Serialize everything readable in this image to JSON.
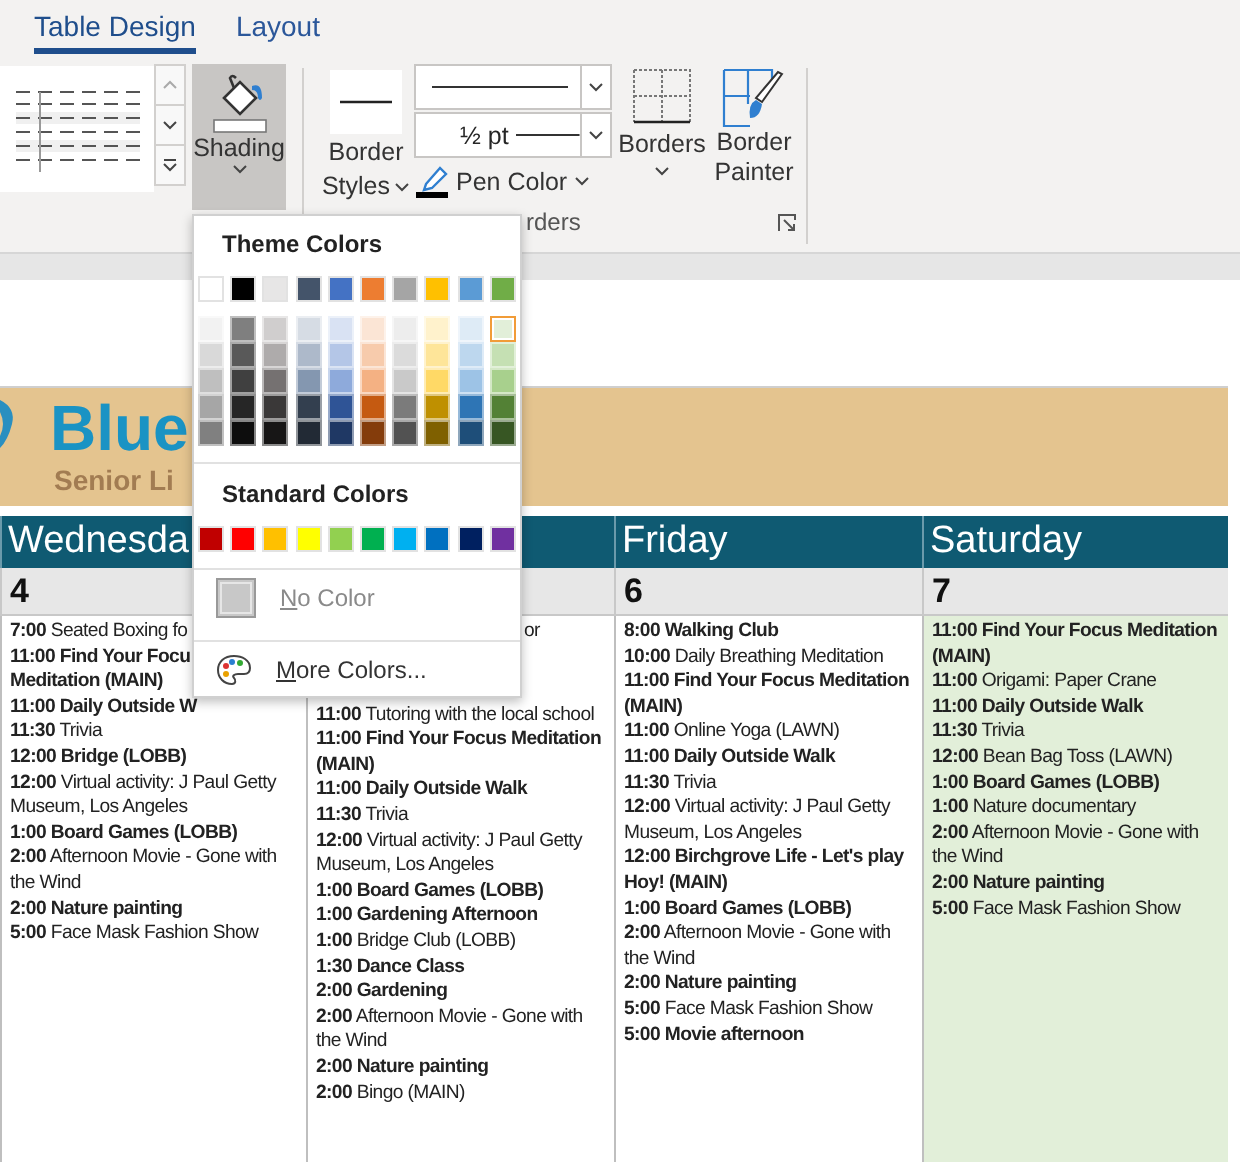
{
  "tabs": [
    {
      "label": "Table Design",
      "selected": true
    },
    {
      "label": "Layout",
      "selected": false
    }
  ],
  "ribbon": {
    "shading_button": {
      "label": "Shading",
      "pressed": true
    },
    "border_styles_button": {
      "label_lines": [
        "Border",
        "Styles"
      ]
    },
    "pen_weight": {
      "value": "½ pt"
    },
    "pen_color_button": {
      "label": "Pen Color"
    },
    "borders_button": {
      "label": "Borders"
    },
    "border_painter_button": {
      "label_lines": [
        "Border",
        "Painter"
      ]
    },
    "group_label": "rders"
  },
  "shading_menu": {
    "theme_title": "Theme Colors",
    "theme_colors": [
      {
        "color": "#ffffff",
        "selected": false,
        "shades": [
          {
            "color": "#f2f2f2",
            "selected": false
          },
          {
            "color": "#d9d9d9",
            "selected": false
          },
          {
            "color": "#bfbfbf",
            "selected": false
          },
          {
            "color": "#a6a6a6",
            "selected": false
          },
          {
            "color": "#808080",
            "selected": false
          }
        ]
      },
      {
        "color": "#000000",
        "selected": false,
        "shades": [
          {
            "color": "#7f7f7f",
            "selected": false
          },
          {
            "color": "#595959",
            "selected": false
          },
          {
            "color": "#404040",
            "selected": false
          },
          {
            "color": "#262626",
            "selected": false
          },
          {
            "color": "#0d0d0d",
            "selected": false
          }
        ]
      },
      {
        "color": "#e7e6e6",
        "selected": false,
        "shades": [
          {
            "color": "#d0cece",
            "selected": false
          },
          {
            "color": "#aeabab",
            "selected": false
          },
          {
            "color": "#757171",
            "selected": false
          },
          {
            "color": "#3a3838",
            "selected": false
          },
          {
            "color": "#171616",
            "selected": false
          }
        ]
      },
      {
        "color": "#44546a",
        "selected": false,
        "shades": [
          {
            "color": "#d6dce4",
            "selected": false
          },
          {
            "color": "#adb9ca",
            "selected": false
          },
          {
            "color": "#8497b0",
            "selected": false
          },
          {
            "color": "#333f4f",
            "selected": false
          },
          {
            "color": "#222a35",
            "selected": false
          }
        ]
      },
      {
        "color": "#4472c4",
        "selected": false,
        "shades": [
          {
            "color": "#d9e2f3",
            "selected": false
          },
          {
            "color": "#b4c6e7",
            "selected": false
          },
          {
            "color": "#8eaadb",
            "selected": false
          },
          {
            "color": "#2f5496",
            "selected": false
          },
          {
            "color": "#1f3864",
            "selected": false
          }
        ]
      },
      {
        "color": "#ed7d31",
        "selected": false,
        "shades": [
          {
            "color": "#fbe5d5",
            "selected": false
          },
          {
            "color": "#f7cbac",
            "selected": false
          },
          {
            "color": "#f4b183",
            "selected": false
          },
          {
            "color": "#c55a11",
            "selected": false
          },
          {
            "color": "#843c0b",
            "selected": false
          }
        ]
      },
      {
        "color": "#a5a5a5",
        "selected": false,
        "shades": [
          {
            "color": "#ededed",
            "selected": false
          },
          {
            "color": "#dbdbdb",
            "selected": false
          },
          {
            "color": "#c9c9c9",
            "selected": false
          },
          {
            "color": "#7b7b7b",
            "selected": false
          },
          {
            "color": "#525252",
            "selected": false
          }
        ]
      },
      {
        "color": "#ffc000",
        "selected": false,
        "shades": [
          {
            "color": "#fff2cc",
            "selected": false
          },
          {
            "color": "#fee599",
            "selected": false
          },
          {
            "color": "#ffd966",
            "selected": false
          },
          {
            "color": "#bf9000",
            "selected": false
          },
          {
            "color": "#7f6000",
            "selected": false
          }
        ]
      },
      {
        "color": "#5b9bd5",
        "selected": false,
        "shades": [
          {
            "color": "#deebf6",
            "selected": false
          },
          {
            "color": "#bdd7ee",
            "selected": false
          },
          {
            "color": "#9dc3e6",
            "selected": false
          },
          {
            "color": "#2e75b5",
            "selected": false
          },
          {
            "color": "#1e4e79",
            "selected": false
          }
        ]
      },
      {
        "color": "#70ad47",
        "selected": false,
        "shades": [
          {
            "color": "#e2efd9",
            "selected": true
          },
          {
            "color": "#c5e0b3",
            "selected": false
          },
          {
            "color": "#a8d08d",
            "selected": false
          },
          {
            "color": "#538135",
            "selected": false
          },
          {
            "color": "#375623",
            "selected": false
          }
        ]
      }
    ],
    "standard_title": "Standard Colors",
    "standard_colors": [
      {
        "color": "#c00000",
        "selected": false
      },
      {
        "color": "#ff0000",
        "selected": false
      },
      {
        "color": "#ffc000",
        "selected": false
      },
      {
        "color": "#ffff00",
        "selected": false
      },
      {
        "color": "#92d050",
        "selected": false
      },
      {
        "color": "#00b050",
        "selected": false
      },
      {
        "color": "#00b0f0",
        "selected": false
      },
      {
        "color": "#0070c0",
        "selected": false
      },
      {
        "color": "#002060",
        "selected": false
      },
      {
        "color": "#7030a0",
        "selected": false
      }
    ],
    "no_color": {
      "label": "No Color",
      "disabled": true
    },
    "more_colors": {
      "label": "More Colors..."
    }
  },
  "banner": {
    "title": "Blue",
    "subtitle": "Senior Li"
  },
  "calendar": {
    "days": [
      {
        "name": "Wednesda",
        "date": "4",
        "events": [
          {
            "time": "7:00",
            "text": "Seated Boxing fo",
            "bold": false
          },
          {
            "time": "11:00",
            "text": "Find Your Focu",
            "bold": true
          },
          {
            "text": "Meditation (MAIN)",
            "bold": true
          },
          {
            "time": "11:00",
            "text": "Daily Outside W",
            "bold": true
          },
          {
            "time": "11:30",
            "text": "Trivia",
            "bold": false
          },
          {
            "time": "12:00",
            "text": "Bridge (LOBB)",
            "bold": true
          },
          {
            "time": "12:00",
            "text": "Virtual activity: J Paul Getty Museum, Los Angeles",
            "bold": false
          },
          {
            "time": "1:00",
            "text": "Board Games (LOBB)",
            "bold": true
          },
          {
            "time": "2:00",
            "text": "Afternoon Movie - Gone with the Wind",
            "bold": false
          },
          {
            "time": "2:00",
            "text": "Nature painting",
            "bold": true
          },
          {
            "time": "5:00",
            "text": "Face Mask Fashion Show",
            "bold": false
          }
        ]
      },
      {
        "events": [
          {
            "text": "or",
            "bold": false,
            "kind": "fragment"
          },
          {
            "time": "11:00",
            "text": "Tutoring with the local school",
            "bold": false
          },
          {
            "time": "11:00",
            "text": "Find Your Focus Meditation (MAIN)",
            "bold": true
          },
          {
            "time": "11:00",
            "text": "Daily Outside Walk",
            "bold": true
          },
          {
            "time": "11:30",
            "text": "Trivia",
            "bold": false
          },
          {
            "time": "12:00",
            "text": "Virtual activity: J Paul Getty Museum, Los Angeles",
            "bold": false
          },
          {
            "time": "1:00",
            "text": "Board Games (LOBB)",
            "bold": true
          },
          {
            "time": "1:00",
            "text": "Gardening Afternoon",
            "bold": true
          },
          {
            "time": "1:00",
            "text": "Bridge Club (LOBB)",
            "bold": false
          },
          {
            "time": "1:30",
            "text": "Dance Class",
            "bold": true
          },
          {
            "time": "2:00",
            "text": "Gardening",
            "bold": true
          },
          {
            "time": "2:00",
            "text": "Afternoon Movie - Gone with the Wind",
            "bold": false
          },
          {
            "time": "2:00",
            "text": "Nature painting",
            "bold": true
          },
          {
            "time": "2:00",
            "text": "Bingo (MAIN)",
            "bold": false
          }
        ]
      },
      {
        "name": "Friday",
        "date": "6",
        "events": [
          {
            "time": "8:00",
            "text": "Walking Club",
            "bold": true
          },
          {
            "time": "10:00",
            "text": "Daily Breathing Meditation",
            "bold": false
          },
          {
            "time": "11:00",
            "text": "Find Your Focus Meditation (MAIN)",
            "bold": true
          },
          {
            "time": "11:00",
            "text": "Online Yoga (LAWN)",
            "bold": false
          },
          {
            "time": "11:00",
            "text": "Daily Outside Walk",
            "bold": true
          },
          {
            "time": "11:30",
            "text": "Trivia",
            "bold": false
          },
          {
            "time": "12:00",
            "text": "Virtual activity: J Paul Getty Museum, Los Angeles",
            "bold": false
          },
          {
            "time": "12:00",
            "text": "Birchgrove Life - Let's play Hoy! (MAIN)",
            "bold": true
          },
          {
            "time": "1:00",
            "text": "Board Games (LOBB)",
            "bold": true
          },
          {
            "time": "2:00",
            "text": "Afternoon Movie - Gone with the Wind",
            "bold": false
          },
          {
            "time": "2:00",
            "text": "Nature painting",
            "bold": true
          },
          {
            "time": "5:00",
            "text": "Face Mask Fashion Show",
            "bold": false
          },
          {
            "time": "5:00",
            "text": "Movie afternoon",
            "bold": true
          }
        ]
      },
      {
        "name": "Saturday",
        "date": "7",
        "color": "#e2efd9",
        "events": [
          {
            "time": "11:00",
            "text": "Find Your Focus Meditation (MAIN)",
            "bold": true
          },
          {
            "time": "11:00",
            "text": "Origami: Paper Crane",
            "bold": false
          },
          {
            "time": "11:00",
            "text": "Daily Outside Walk",
            "bold": true
          },
          {
            "time": "11:30",
            "text": "Trivia",
            "bold": false
          },
          {
            "time": "12:00",
            "text": "Bean Bag Toss (LAWN)",
            "bold": false
          },
          {
            "time": "1:00",
            "text": "Board Games (LOBB)",
            "bold": true
          },
          {
            "time": "1:00",
            "text": "Nature documentary",
            "bold": false
          },
          {
            "time": "2:00",
            "text": "Afternoon Movie - Gone with the Wind",
            "bold": false
          },
          {
            "time": "2:00",
            "text": "Nature painting",
            "bold": true
          },
          {
            "time": "5:00",
            "text": "Face Mask Fashion Show",
            "bold": false
          }
        ]
      }
    ]
  }
}
